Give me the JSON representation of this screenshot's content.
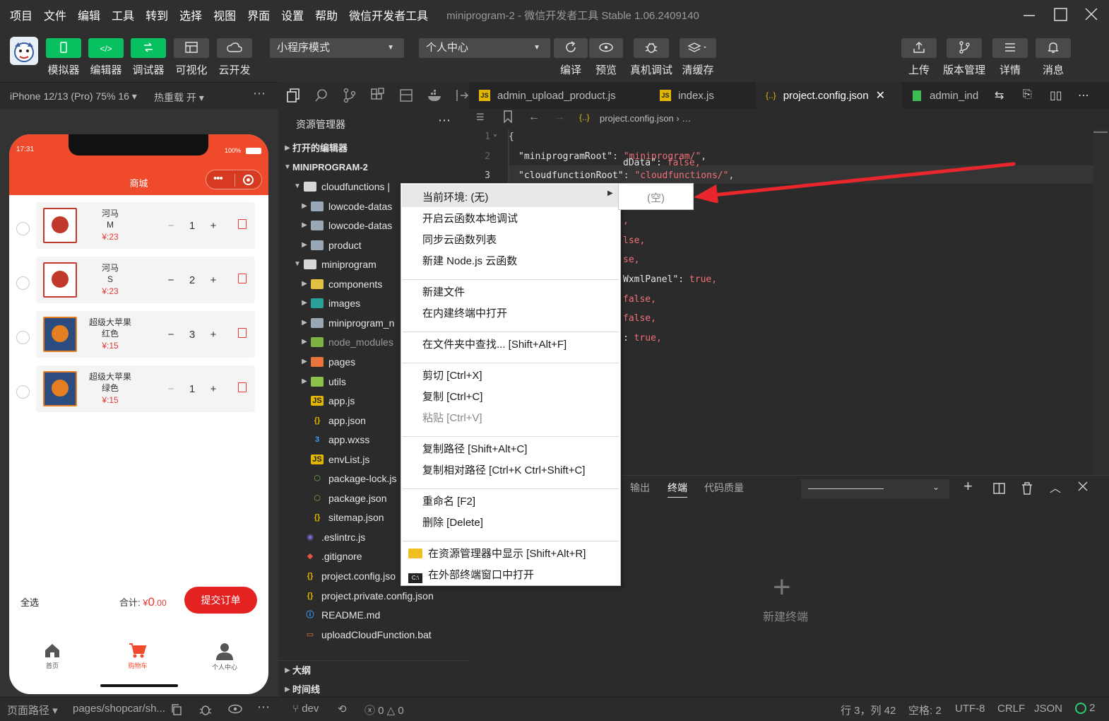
{
  "menubar": {
    "items": [
      "项目",
      "文件",
      "编辑",
      "工具",
      "转到",
      "选择",
      "视图",
      "界面",
      "设置",
      "帮助",
      "微信开发者工具"
    ],
    "window_title": "miniprogram-2 - 微信开发者工具 Stable 1.06.2409140"
  },
  "toolbar": {
    "left_buttons": [
      {
        "label": "模拟器",
        "icon": "phone-icon"
      },
      {
        "label": "编辑器",
        "icon": "code-icon"
      },
      {
        "label": "调试器",
        "icon": "debug-toggle-icon"
      },
      {
        "label": "可视化",
        "icon": "layout-icon"
      },
      {
        "label": "云开发",
        "icon": "cloud-icon"
      }
    ],
    "mode_select": "小程序模式",
    "page_select": "个人中心",
    "mid_buttons": [
      {
        "label": "编译",
        "icon": "refresh-icon"
      },
      {
        "label": "预览",
        "icon": "eye-icon"
      },
      {
        "label": "真机调试",
        "icon": "bug-icon"
      },
      {
        "label": "清缓存",
        "icon": "layers-icon"
      }
    ],
    "right_buttons": [
      {
        "label": "上传",
        "icon": "upload-icon"
      },
      {
        "label": "版本管理",
        "icon": "branch-icon"
      },
      {
        "label": "详情",
        "icon": "menu-icon"
      },
      {
        "label": "消息",
        "icon": "bell-icon"
      }
    ]
  },
  "simulator": {
    "device": "iPhone 12/13 (Pro) 75% 16",
    "hot_reload": "热重载 开",
    "time": "17:31",
    "battery": "100%",
    "page_title": "商城",
    "items": [
      {
        "name": "河马",
        "spec": "M",
        "price": "¥:23",
        "qty": "1"
      },
      {
        "name": "河马",
        "spec": "S",
        "price": "¥:23",
        "qty": "2"
      },
      {
        "name": "超级大苹果",
        "spec": "红色",
        "price": "¥:15",
        "qty": "3"
      },
      {
        "name": "超级大苹果",
        "spec": "绿色",
        "price": "¥:15",
        "qty": "1"
      }
    ],
    "select_all": "全选",
    "total_label": "合计:",
    "total_currency": "¥",
    "total_int": "0",
    "total_dec": ".00",
    "submit": "提交订单",
    "tabbar": [
      "首页",
      "购物车",
      "个人中心"
    ]
  },
  "explorer": {
    "title": "资源管理器",
    "open_editors": "打开的编辑器",
    "project": "MINIPROGRAM-2",
    "tree": [
      {
        "label": "cloudfunctions |",
        "depth": 1,
        "arrow": "open",
        "type": "folder-open"
      },
      {
        "label": "lowcode-datas",
        "depth": 2,
        "arrow": "closed",
        "type": "folder"
      },
      {
        "label": "lowcode-datas",
        "depth": 2,
        "arrow": "closed",
        "type": "folder"
      },
      {
        "label": "product",
        "depth": 2,
        "arrow": "closed",
        "type": "folder"
      },
      {
        "label": "miniprogram",
        "depth": 1,
        "arrow": "open",
        "type": "folder-open"
      },
      {
        "label": "components",
        "depth": 2,
        "arrow": "closed",
        "type": "folder-yellow"
      },
      {
        "label": "images",
        "depth": 2,
        "arrow": "closed",
        "type": "folder-teal"
      },
      {
        "label": "miniprogram_n",
        "depth": 2,
        "arrow": "closed",
        "type": "folder"
      },
      {
        "label": "node_modules",
        "depth": 2,
        "arrow": "closed",
        "type": "folder-green"
      },
      {
        "label": "pages",
        "depth": 2,
        "arrow": "closed",
        "type": "folder-orange"
      },
      {
        "label": "utils",
        "depth": 2,
        "arrow": "closed",
        "type": "folder-lime"
      },
      {
        "label": "app.js",
        "depth": 2,
        "arrow": "none",
        "type": "js"
      },
      {
        "label": "app.json",
        "depth": 2,
        "arrow": "none",
        "type": "json"
      },
      {
        "label": "app.wxss",
        "depth": 2,
        "arrow": "none",
        "type": "css"
      },
      {
        "label": "envList.js",
        "depth": 2,
        "arrow": "none",
        "type": "js"
      },
      {
        "label": "package-lock.js",
        "depth": 2,
        "arrow": "none",
        "type": "node"
      },
      {
        "label": "package.json",
        "depth": 2,
        "arrow": "none",
        "type": "node"
      },
      {
        "label": "sitemap.json",
        "depth": 2,
        "arrow": "none",
        "type": "json"
      },
      {
        "label": ".eslintrc.js",
        "depth": 1,
        "arrow": "none",
        "type": "eslint"
      },
      {
        "label": ".gitignore",
        "depth": 1,
        "arrow": "none",
        "type": "git"
      },
      {
        "label": "project.config.jso",
        "depth": 1,
        "arrow": "none",
        "type": "json"
      },
      {
        "label": "project.private.config.json",
        "depth": 1,
        "arrow": "none",
        "type": "json"
      },
      {
        "label": "README.md",
        "depth": 1,
        "arrow": "none",
        "type": "info"
      },
      {
        "label": "uploadCloudFunction.bat",
        "depth": 1,
        "arrow": "none",
        "type": "bat"
      }
    ],
    "outline": "大纲",
    "timeline": "时间线"
  },
  "editor": {
    "tabs": [
      {
        "label": "admin_upload_product.js",
        "type": "js"
      },
      {
        "label": "index.js",
        "type": "js"
      },
      {
        "label": "project.config.json",
        "type": "json",
        "active": true
      },
      {
        "label": "admin_ind",
        "type": "wxml"
      }
    ],
    "breadcrumb": "project.config.json",
    "breadcrumb_tail": "…",
    "lines": [
      {
        "n": "1",
        "text": "{"
      },
      {
        "n": "2",
        "key": "\"miniprogramRoot\"",
        "val": "\"miniprogram/\""
      },
      {
        "n": "3",
        "key": "\"cloudfunctionRoot\"",
        "val": "\"cloudfunctions/\""
      }
    ],
    "fragments": [
      {
        "key": "dData\": ",
        "val": "false,"
      },
      {
        "key": "",
        "val": "e,"
      },
      {
        "key": "",
        "val": ","
      },
      {
        "key": "",
        "val": "lse,"
      },
      {
        "key": "",
        "val": "se,"
      },
      {
        "key": "WxmlPanel\": ",
        "val": "true,"
      },
      {
        "key": "",
        "val": "false,"
      },
      {
        "key": "",
        "val": "false,"
      },
      {
        "key": ": ",
        "val": "true,"
      }
    ]
  },
  "panel": {
    "tabs": [
      "输出",
      "终端",
      "代码质量"
    ],
    "active_tab": "终端",
    "new_terminal": "新建终端"
  },
  "context_menu": {
    "items": [
      {
        "label": "当前环境: (无)",
        "submenu": true
      },
      {
        "label": "开启云函数本地调试"
      },
      {
        "label": "同步云函数列表"
      },
      {
        "label": "新建 Node.js 云函数"
      },
      {
        "sep": true
      },
      {
        "label": "新建文件"
      },
      {
        "label": "在内建终端中打开"
      },
      {
        "sep": true
      },
      {
        "label": "在文件夹中查找...  [Shift+Alt+F]"
      },
      {
        "sep": true
      },
      {
        "label": "剪切  [Ctrl+X]"
      },
      {
        "label": "复制  [Ctrl+C]"
      },
      {
        "label": "粘贴  [Ctrl+V]",
        "disabled": true
      },
      {
        "sep": true
      },
      {
        "label": "复制路径  [Shift+Alt+C]"
      },
      {
        "label": "复制相对路径  [Ctrl+K Ctrl+Shift+C]"
      },
      {
        "sep": true
      },
      {
        "label": "重命名  [F2]"
      },
      {
        "label": "删除  [Delete]"
      },
      {
        "sep": true
      },
      {
        "label": "在资源管理器中显示  [Shift+Alt+R]",
        "icon": "folder"
      },
      {
        "label": "在外部终端窗口中打开",
        "icon": "cmd"
      }
    ],
    "submenu_item": "(空)"
  },
  "statusbar": {
    "page_path_label": "页面路径",
    "page_path": "pages/shopcar/sh...",
    "branch": "dev",
    "errors": "0",
    "warnings": "0",
    "position": "行 3，列 42",
    "spaces": "空格: 2",
    "encoding": "UTF-8",
    "eol": "CRLF",
    "language": "JSON",
    "notifications": "2"
  },
  "colors": {
    "accent_green": "#07c160",
    "header_red": "#f04a2d",
    "price_red": "#e53935",
    "arrow_red": "#e8262c"
  }
}
